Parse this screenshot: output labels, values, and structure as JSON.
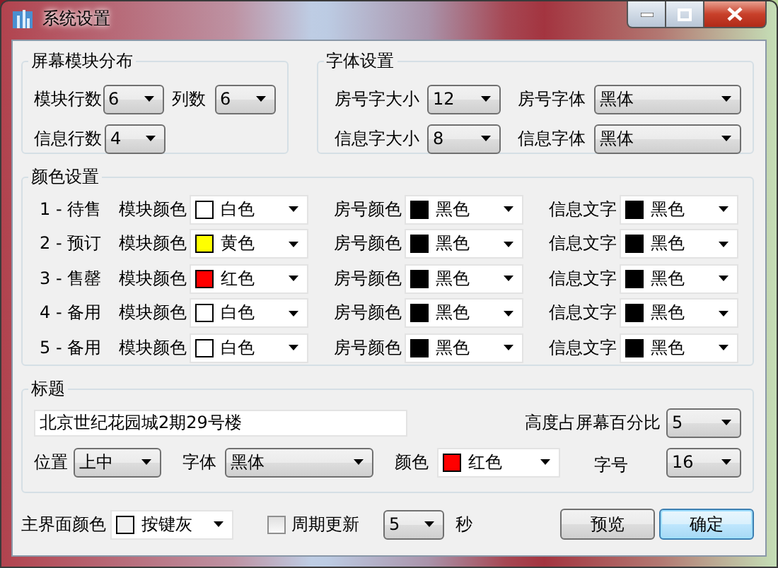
{
  "window": {
    "title": "系统设置"
  },
  "layout_group": {
    "title": "屏幕模块分布",
    "fields": [
      {
        "label": "模块行数",
        "value": "6"
      },
      {
        "label": "列数",
        "value": "6"
      },
      {
        "label": "信息行数",
        "value": "4"
      }
    ]
  },
  "font_group": {
    "title": "字体设置",
    "fields": [
      {
        "label": "房号字大小",
        "value": "12"
      },
      {
        "label": "房号字体",
        "value": "黑体"
      },
      {
        "label": "信息字大小",
        "value": "8"
      },
      {
        "label": "信息字体",
        "value": "黑体"
      }
    ]
  },
  "color_group": {
    "title": "颜色设置",
    "rows": [
      {
        "name": "1 - 待售",
        "settings": [
          {
            "label": "模块颜色",
            "value": "白色",
            "color": "#ffffff"
          },
          {
            "label": "房号颜色",
            "value": "黑色",
            "color": "#000000"
          },
          {
            "label": "信息文字",
            "value": "黑色",
            "color": "#000000"
          }
        ]
      },
      {
        "name": "2 - 预订",
        "settings": [
          {
            "label": "模块颜色",
            "value": "黄色",
            "color": "#ffff00"
          },
          {
            "label": "房号颜色",
            "value": "黑色",
            "color": "#000000"
          },
          {
            "label": "信息文字",
            "value": "黑色",
            "color": "#000000"
          }
        ]
      },
      {
        "name": "3 - 售罄",
        "settings": [
          {
            "label": "模块颜色",
            "value": "红色",
            "color": "#ff0000"
          },
          {
            "label": "房号颜色",
            "value": "黑色",
            "color": "#000000"
          },
          {
            "label": "信息文字",
            "value": "黑色",
            "color": "#000000"
          }
        ]
      },
      {
        "name": "4 - 备用",
        "settings": [
          {
            "label": "模块颜色",
            "value": "白色",
            "color": "#ffffff"
          },
          {
            "label": "房号颜色",
            "value": "黑色",
            "color": "#000000"
          },
          {
            "label": "信息文字",
            "value": "黑色",
            "color": "#000000"
          }
        ]
      },
      {
        "name": "5 - 备用",
        "settings": [
          {
            "label": "模块颜色",
            "value": "白色",
            "color": "#ffffff"
          },
          {
            "label": "房号颜色",
            "value": "黑色",
            "color": "#000000"
          },
          {
            "label": "信息文字",
            "value": "黑色",
            "color": "#000000"
          }
        ]
      }
    ]
  },
  "title_group": {
    "title": "标题",
    "text": "北京世纪花园城2期29号楼",
    "height": {
      "label": "高度占屏幕百分比",
      "value": "5"
    },
    "fields": [
      {
        "kind": "combo",
        "label": "位置",
        "value": "上中"
      },
      {
        "kind": "combo",
        "label": "字体",
        "value": "黑体"
      },
      {
        "kind": "color",
        "label": "颜色",
        "value": "红色",
        "color": "#ff0000"
      },
      {
        "kind": "combo",
        "label": "字号",
        "value": "16"
      }
    ]
  },
  "main_color": {
    "label": "主界面颜色",
    "value": "按键灰",
    "color": "#f0f0f0"
  },
  "periodic_update": {
    "label": "周期更新",
    "checked": false,
    "interval": "5",
    "unit": "秒"
  },
  "buttons": [
    {
      "label": "预览",
      "default": false
    },
    {
      "label": "确定",
      "default": true
    }
  ]
}
